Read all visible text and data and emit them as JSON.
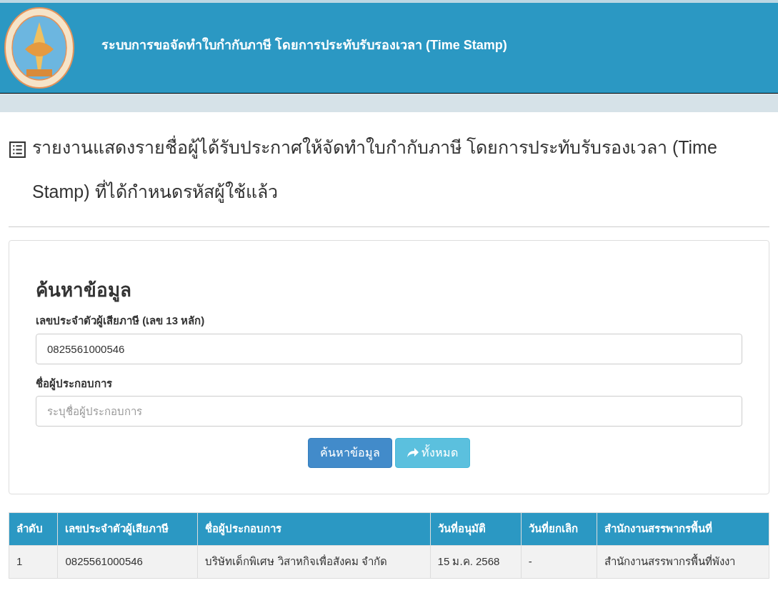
{
  "header": {
    "title": "ระบบการขอจัดทำใบกำกับภาษี โดยการประทับรับรองเวลา (Time Stamp)"
  },
  "page_title": "รายงานแสดงรายชื่อผู้ได้รับประกาศให้จัดทำใบกำกับภาษี โดยการประทับรับรองเวลา (Time Stamp) ที่ได้กำหนดรหัสผู้ใช้แล้ว",
  "search": {
    "heading": "ค้นหาข้อมูล",
    "fields": [
      {
        "label": "เลขประจำตัวผู้เสียภาษี (เลข 13 หลัก)",
        "value": "0825561000546"
      },
      {
        "label": "ชื่อผู้ประกอบการ",
        "placeholder": "ระบุชื่อผู้ประกอบการ"
      }
    ],
    "buttons": [
      {
        "kind": "primary",
        "label": "ค้นหาข้อมูล"
      },
      {
        "kind": "info",
        "label": "ทั้งหมด"
      }
    ]
  },
  "table": {
    "columns": [
      "ลำดับ",
      "เลขประจำตัวผู้เสียภาษี",
      "ชื่อผู้ประกอบการ",
      "วันที่อนุมัติ",
      "วันที่ยกเลิก",
      "สำนักงานสรรพากรพื้นที่"
    ],
    "rows": [
      [
        "1",
        "0825561000546",
        "บริษัทเด็กพิเศษ วิสาหกิจเพื่อสังคม จำกัด",
        "15 ม.ค. 2568",
        "-",
        "สำนักงานสรรพากรพื้นที่พังงา"
      ]
    ]
  }
}
